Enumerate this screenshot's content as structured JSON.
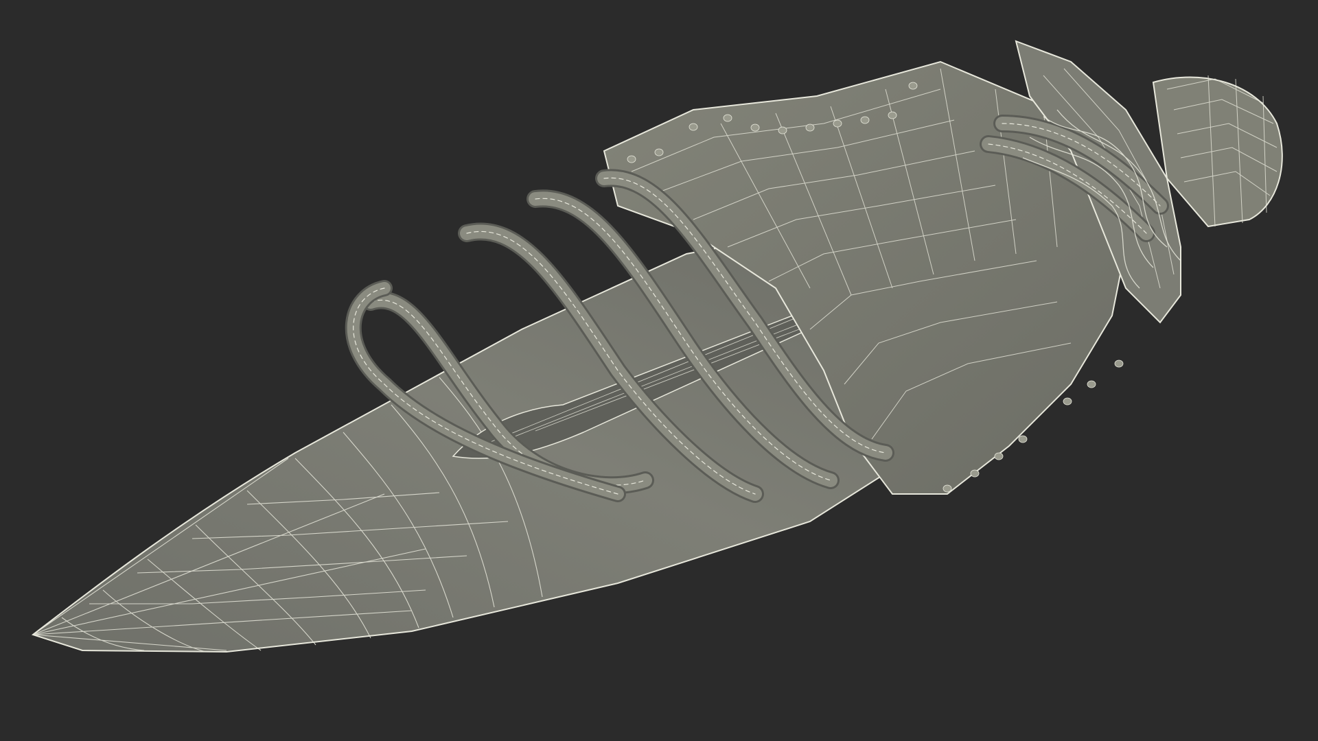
{
  "scene": {
    "subject": "wireframe-dagger-in-sheath",
    "colors": {
      "background": "#2b2b2b",
      "mesh_fill": "#7b7c72",
      "mesh_fill_dark": "#5f605a",
      "mesh_fill_light": "#8a8b80",
      "wire": "#e8e8dc",
      "shadow": "#3a3a36"
    }
  }
}
